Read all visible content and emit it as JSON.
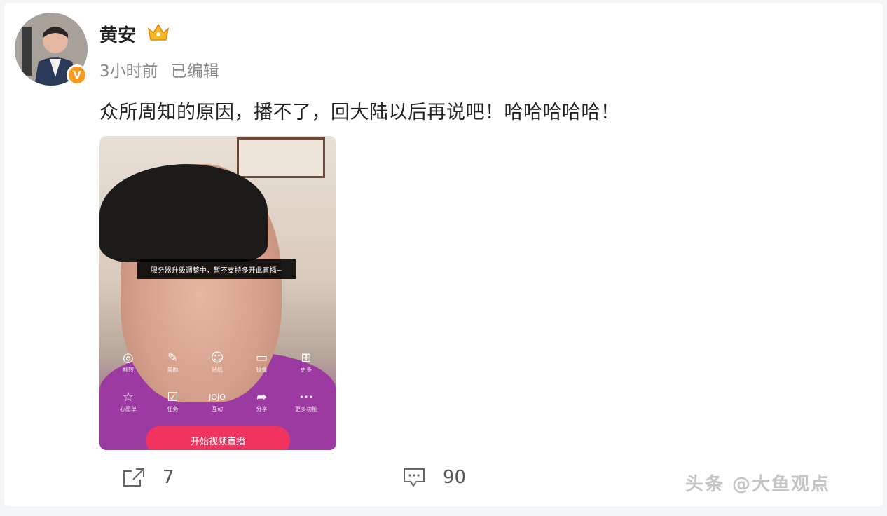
{
  "post": {
    "author": "黄安",
    "time": "3小时前",
    "edited": "已编辑",
    "text": "众所周知的原因，播不了，回大陆以后再说吧！哈哈哈哈哈！"
  },
  "media": {
    "notice": "服务器升级调整中，暂不支持多开此直播~",
    "tools_row1": [
      {
        "icon": "camera-flip-icon",
        "glyph": "◎",
        "label": "翻转"
      },
      {
        "icon": "beauty-pen-icon",
        "glyph": "✎",
        "label": "美颜"
      },
      {
        "icon": "sticker-face-icon",
        "glyph": "☺",
        "label": "贴纸"
      },
      {
        "icon": "mirror-icon",
        "glyph": "▭",
        "label": "镜像"
      },
      {
        "icon": "grid-icon",
        "glyph": "⊞",
        "label": "更多"
      }
    ],
    "tools_row2": [
      {
        "icon": "star-icon",
        "glyph": "☆",
        "label": "心愿单"
      },
      {
        "icon": "task-check-icon",
        "glyph": "☑",
        "label": "任务"
      },
      {
        "icon": "jojo-icon",
        "glyph": "JOJO",
        "label": "互动"
      },
      {
        "icon": "share-icon",
        "glyph": "➦",
        "label": "分享"
      },
      {
        "icon": "more-dots-icon",
        "glyph": "•••",
        "label": "更多功能"
      }
    ],
    "live_button": "开始视频直播"
  },
  "actions": {
    "repost_count": "7",
    "comment_count": "90"
  },
  "watermark": "头条 @大鱼观点",
  "colors": {
    "accent": "#f79b1e",
    "live": "#f0345f",
    "text": "#222222",
    "muted": "#8a8a8a"
  }
}
